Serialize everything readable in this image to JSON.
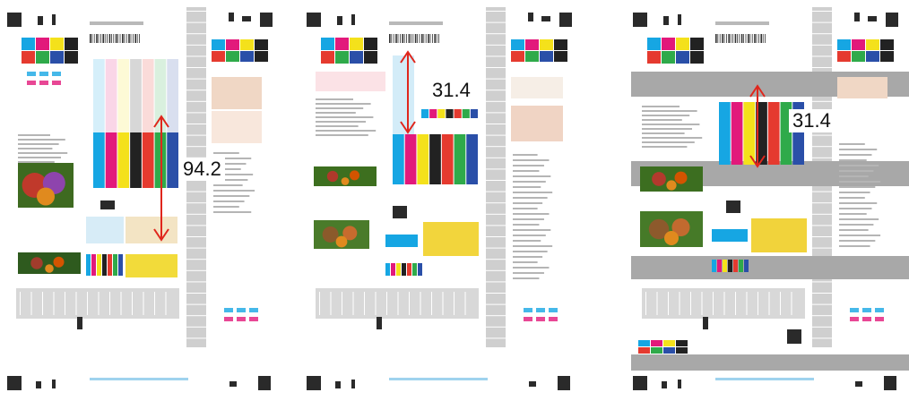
{
  "image_title": "",
  "panels": [
    {
      "name": "panel-left",
      "measurement": "94.2",
      "colors": {
        "arrow": "#e0261c"
      }
    },
    {
      "name": "panel-middle",
      "measurement": "31.4",
      "colors": {
        "arrow": "#e0261c"
      }
    },
    {
      "name": "panel-right",
      "measurement": "31.4",
      "colors": {
        "arrow": "#e0261c"
      }
    }
  ],
  "palette": {
    "cyan": "#16a6e3",
    "magenta": "#e2197b",
    "yellow": "#f4e11b",
    "black": "#222222",
    "red": "#e53a2f",
    "green": "#2faa4a",
    "blue": "#2a4fa8",
    "gray": "#9a9a9a"
  }
}
